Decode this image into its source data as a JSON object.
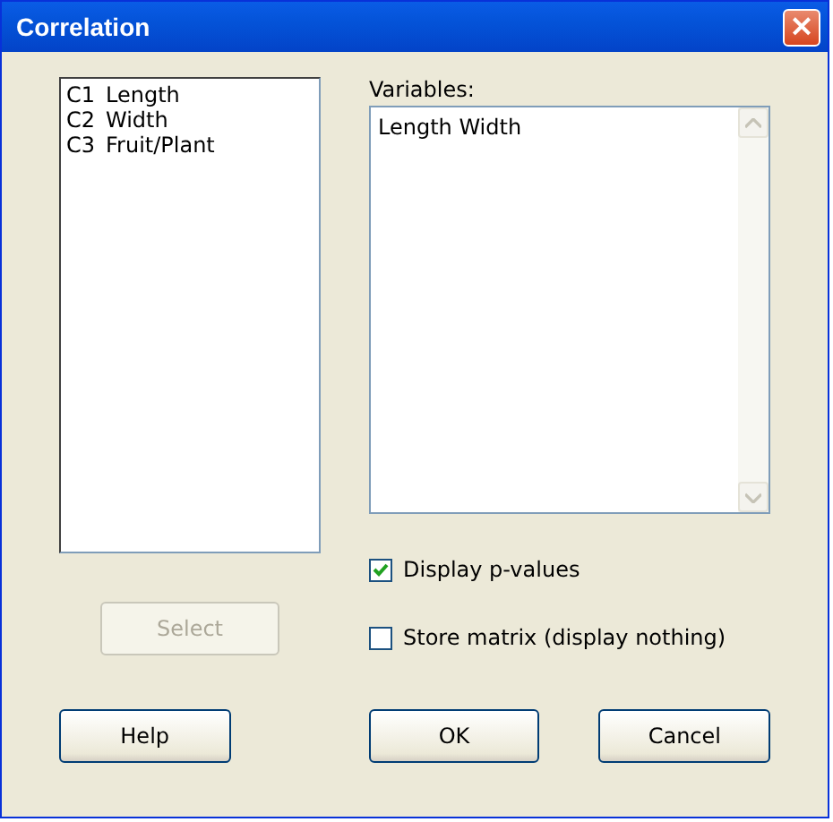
{
  "window": {
    "title": "Correlation",
    "close": "×"
  },
  "columns_list": [
    {
      "id": "C1",
      "name": "Length"
    },
    {
      "id": "C2",
      "name": "Width"
    },
    {
      "id": "C3",
      "name": "Fruit/Plant"
    }
  ],
  "variables": {
    "label": "Variables:",
    "value": "Length Width"
  },
  "options": [
    {
      "label": "Display p-values",
      "checked": true
    },
    {
      "label": "Store matrix (display nothing)",
      "checked": false
    }
  ],
  "select_button": {
    "label": "Select",
    "disabled": true
  },
  "buttons": [
    {
      "label": "Help"
    },
    {
      "label": "OK"
    },
    {
      "label": "Cancel"
    }
  ]
}
